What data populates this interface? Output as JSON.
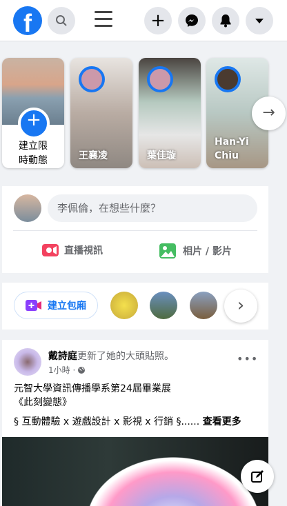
{
  "header": {
    "logo": "f",
    "icons": [
      "search-icon",
      "menu-icon",
      "plus-icon",
      "messenger-icon",
      "notifications-icon",
      "dropdown-icon"
    ]
  },
  "stories": {
    "create_label_line1": "建立限",
    "create_label_line2": "時動態",
    "items": [
      {
        "name": "王襄凌"
      },
      {
        "name": "葉佳璇"
      },
      {
        "name": "Han-Yi Chiu"
      }
    ]
  },
  "composer": {
    "placeholder": "李佩倫，在想些什麼？",
    "live_label": "直播視訊",
    "photo_label": "相片 / 影片"
  },
  "rooms": {
    "create_label": "建立包廂"
  },
  "post": {
    "author": "戴詩庭",
    "action": "更新了她的大頭貼照。",
    "time": "1小時 ·",
    "line1": "元智大學資訊傳播學系第24屆畢業展",
    "line2": "《此刻變態》",
    "line3": "§ 互動體驗 x 遊戲設計 x 影視 x 行銷 §......",
    "see_more": "查看更多"
  },
  "colors": {
    "accent": "#1877f2",
    "background": "#f0f2f5"
  }
}
